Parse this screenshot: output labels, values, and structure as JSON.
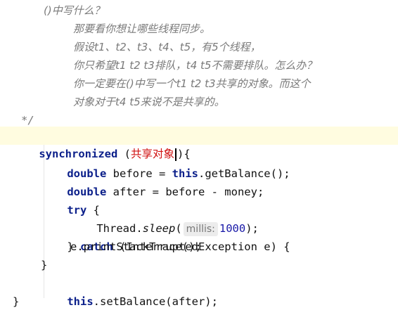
{
  "editor": {
    "comment_lines": [
      "()中写什么？",
      "那要看你想让哪些线程同步。",
      "假设t1、t2、t3、t4、t5，有5个线程，",
      "你只希望t1 t2 t3排队，t4 t5不需要排队。怎么办？",
      "你一定要在()中写一个t1 t2 t3共享的对象。而这个",
      "对象对于t4 t5来说不是共享的。"
    ],
    "comment_end": "*/",
    "sync_keyword": "synchronized",
    "sync_open": " (",
    "sync_arg": "共享对象",
    "sync_close": "){",
    "line_before_kw": "double",
    "line_before_mid": " before = ",
    "line_before_this": "this",
    "line_before_rest": ".getBalance();",
    "line_after_kw": "double",
    "line_after_rest": " after = before - money;",
    "try_kw": "try",
    "try_rest": " {",
    "sleep_pre": "Thread.",
    "sleep_method": "sleep",
    "sleep_open": "(",
    "sleep_hint": "millis:",
    "sleep_value": "1000",
    "sleep_close": ");",
    "catch_pre": "} ",
    "catch_kw": "catch",
    "catch_rest": " (InterruptedException e) {",
    "print_line": "e.printStackTrace();",
    "close_brace_inner": "}",
    "set_this": "this",
    "set_rest": ".setBalance(after);",
    "close_brace_outer": "}"
  }
}
